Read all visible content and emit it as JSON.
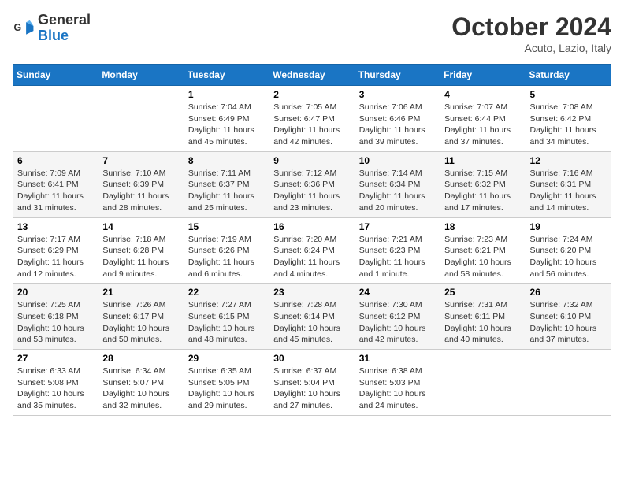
{
  "header": {
    "logo_text_general": "General",
    "logo_text_blue": "Blue",
    "month_title": "October 2024",
    "location": "Acuto, Lazio, Italy"
  },
  "weekdays": [
    "Sunday",
    "Monday",
    "Tuesday",
    "Wednesday",
    "Thursday",
    "Friday",
    "Saturday"
  ],
  "weeks": [
    [
      {
        "day": "",
        "info": ""
      },
      {
        "day": "",
        "info": ""
      },
      {
        "day": "1",
        "info": "Sunrise: 7:04 AM\nSunset: 6:49 PM\nDaylight: 11 hours and 45 minutes."
      },
      {
        "day": "2",
        "info": "Sunrise: 7:05 AM\nSunset: 6:47 PM\nDaylight: 11 hours and 42 minutes."
      },
      {
        "day": "3",
        "info": "Sunrise: 7:06 AM\nSunset: 6:46 PM\nDaylight: 11 hours and 39 minutes."
      },
      {
        "day": "4",
        "info": "Sunrise: 7:07 AM\nSunset: 6:44 PM\nDaylight: 11 hours and 37 minutes."
      },
      {
        "day": "5",
        "info": "Sunrise: 7:08 AM\nSunset: 6:42 PM\nDaylight: 11 hours and 34 minutes."
      }
    ],
    [
      {
        "day": "6",
        "info": "Sunrise: 7:09 AM\nSunset: 6:41 PM\nDaylight: 11 hours and 31 minutes."
      },
      {
        "day": "7",
        "info": "Sunrise: 7:10 AM\nSunset: 6:39 PM\nDaylight: 11 hours and 28 minutes."
      },
      {
        "day": "8",
        "info": "Sunrise: 7:11 AM\nSunset: 6:37 PM\nDaylight: 11 hours and 25 minutes."
      },
      {
        "day": "9",
        "info": "Sunrise: 7:12 AM\nSunset: 6:36 PM\nDaylight: 11 hours and 23 minutes."
      },
      {
        "day": "10",
        "info": "Sunrise: 7:14 AM\nSunset: 6:34 PM\nDaylight: 11 hours and 20 minutes."
      },
      {
        "day": "11",
        "info": "Sunrise: 7:15 AM\nSunset: 6:32 PM\nDaylight: 11 hours and 17 minutes."
      },
      {
        "day": "12",
        "info": "Sunrise: 7:16 AM\nSunset: 6:31 PM\nDaylight: 11 hours and 14 minutes."
      }
    ],
    [
      {
        "day": "13",
        "info": "Sunrise: 7:17 AM\nSunset: 6:29 PM\nDaylight: 11 hours and 12 minutes."
      },
      {
        "day": "14",
        "info": "Sunrise: 7:18 AM\nSunset: 6:28 PM\nDaylight: 11 hours and 9 minutes."
      },
      {
        "day": "15",
        "info": "Sunrise: 7:19 AM\nSunset: 6:26 PM\nDaylight: 11 hours and 6 minutes."
      },
      {
        "day": "16",
        "info": "Sunrise: 7:20 AM\nSunset: 6:24 PM\nDaylight: 11 hours and 4 minutes."
      },
      {
        "day": "17",
        "info": "Sunrise: 7:21 AM\nSunset: 6:23 PM\nDaylight: 11 hours and 1 minute."
      },
      {
        "day": "18",
        "info": "Sunrise: 7:23 AM\nSunset: 6:21 PM\nDaylight: 10 hours and 58 minutes."
      },
      {
        "day": "19",
        "info": "Sunrise: 7:24 AM\nSunset: 6:20 PM\nDaylight: 10 hours and 56 minutes."
      }
    ],
    [
      {
        "day": "20",
        "info": "Sunrise: 7:25 AM\nSunset: 6:18 PM\nDaylight: 10 hours and 53 minutes."
      },
      {
        "day": "21",
        "info": "Sunrise: 7:26 AM\nSunset: 6:17 PM\nDaylight: 10 hours and 50 minutes."
      },
      {
        "day": "22",
        "info": "Sunrise: 7:27 AM\nSunset: 6:15 PM\nDaylight: 10 hours and 48 minutes."
      },
      {
        "day": "23",
        "info": "Sunrise: 7:28 AM\nSunset: 6:14 PM\nDaylight: 10 hours and 45 minutes."
      },
      {
        "day": "24",
        "info": "Sunrise: 7:30 AM\nSunset: 6:12 PM\nDaylight: 10 hours and 42 minutes."
      },
      {
        "day": "25",
        "info": "Sunrise: 7:31 AM\nSunset: 6:11 PM\nDaylight: 10 hours and 40 minutes."
      },
      {
        "day": "26",
        "info": "Sunrise: 7:32 AM\nSunset: 6:10 PM\nDaylight: 10 hours and 37 minutes."
      }
    ],
    [
      {
        "day": "27",
        "info": "Sunrise: 6:33 AM\nSunset: 5:08 PM\nDaylight: 10 hours and 35 minutes."
      },
      {
        "day": "28",
        "info": "Sunrise: 6:34 AM\nSunset: 5:07 PM\nDaylight: 10 hours and 32 minutes."
      },
      {
        "day": "29",
        "info": "Sunrise: 6:35 AM\nSunset: 5:05 PM\nDaylight: 10 hours and 29 minutes."
      },
      {
        "day": "30",
        "info": "Sunrise: 6:37 AM\nSunset: 5:04 PM\nDaylight: 10 hours and 27 minutes."
      },
      {
        "day": "31",
        "info": "Sunrise: 6:38 AM\nSunset: 5:03 PM\nDaylight: 10 hours and 24 minutes."
      },
      {
        "day": "",
        "info": ""
      },
      {
        "day": "",
        "info": ""
      }
    ]
  ]
}
